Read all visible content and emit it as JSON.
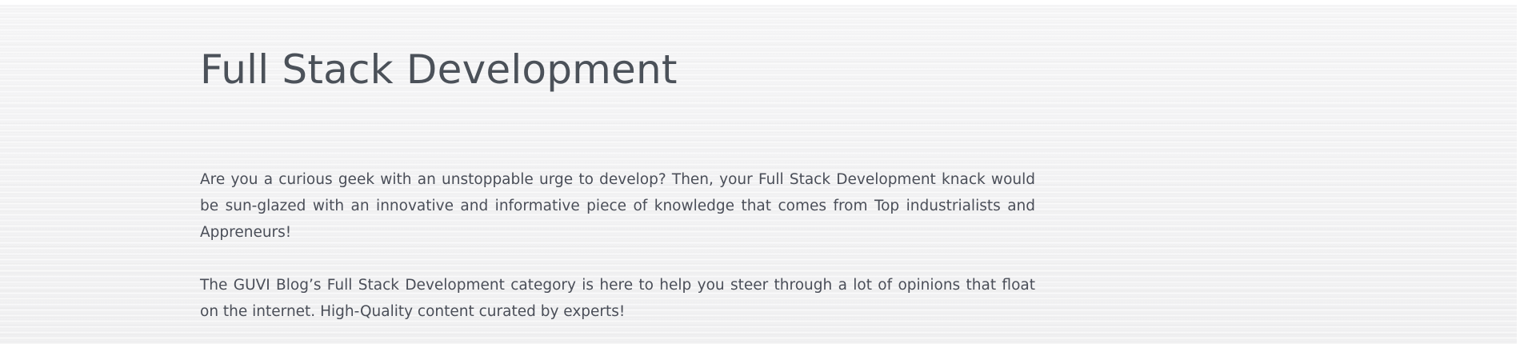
{
  "section": {
    "title": "Full Stack Development",
    "paragraphs": [
      "Are you a curious geek with an unstoppable urge to develop? Then, your Full Stack Development knack would be sun-glazed with an innovative and informative piece of knowledge that comes from Top industrialists and Appreneurs!",
      "The GUVI Blog’s Full Stack Development category is here to help you steer through a lot of opinions that float on the internet. High-Quality content curated by experts!"
    ]
  },
  "colors": {
    "background": "#f4f4f5",
    "heading": "#4b5159",
    "body_text": "#4a4e58"
  }
}
